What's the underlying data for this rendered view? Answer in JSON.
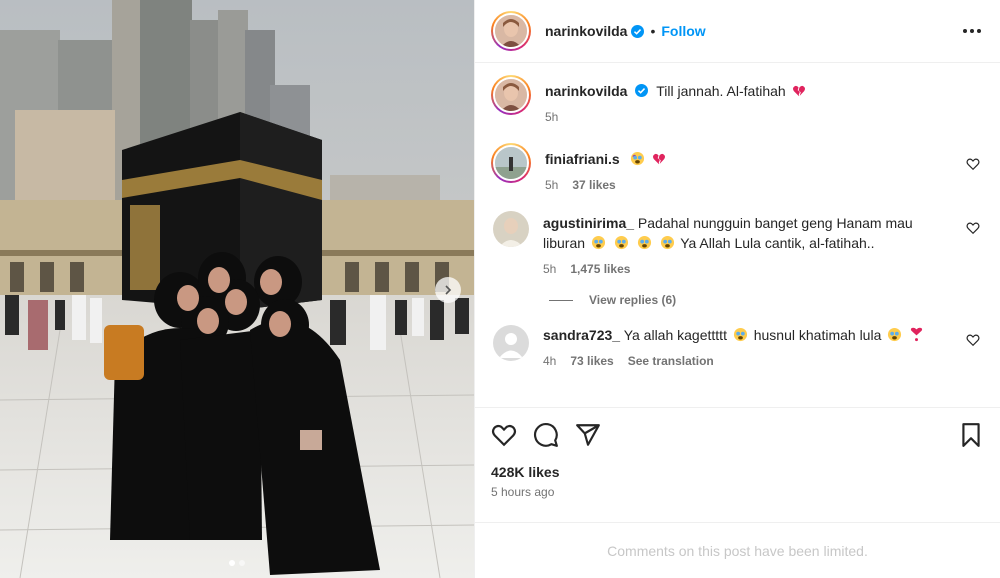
{
  "post": {
    "author": "narinkovilda",
    "follow_label": "Follow",
    "dot_separator": "•"
  },
  "caption": {
    "username": "narinkovilda",
    "text": "Till jannah. Al-fatihah",
    "time": "5h"
  },
  "comments": [
    {
      "username": "finiafriani.s",
      "text": "",
      "time": "5h",
      "likes": "37 likes"
    },
    {
      "username": "agustinirima_",
      "text": "Padahal nungguin banget geng Hanam mau liburan",
      "text2": "Ya Allah Lula cantik, al-fatihah..",
      "time": "5h",
      "likes": "1,475 likes"
    },
    {
      "username": "sandra723_",
      "text": "Ya allah kagettttt",
      "text2": "husnul khatimah lula",
      "time": "4h",
      "likes": "73 likes",
      "translate": "See translation"
    }
  ],
  "view_replies": "View replies (6)",
  "stats": {
    "likes": "428K likes",
    "posted": "5 hours ago"
  },
  "limited_notice": "Comments on this post have been limited.",
  "icons": {
    "heart": "heart-icon",
    "comment": "comment-icon",
    "share": "share-icon",
    "save": "bookmark-icon",
    "more": "more-icon",
    "verified": "verified-badge-icon",
    "next": "chevron-right-icon"
  },
  "colors": {
    "accent": "#0095f6",
    "broken_heart": "#e0245e",
    "muted": "#737373"
  },
  "carousel": {
    "current": 1,
    "total": 2
  }
}
